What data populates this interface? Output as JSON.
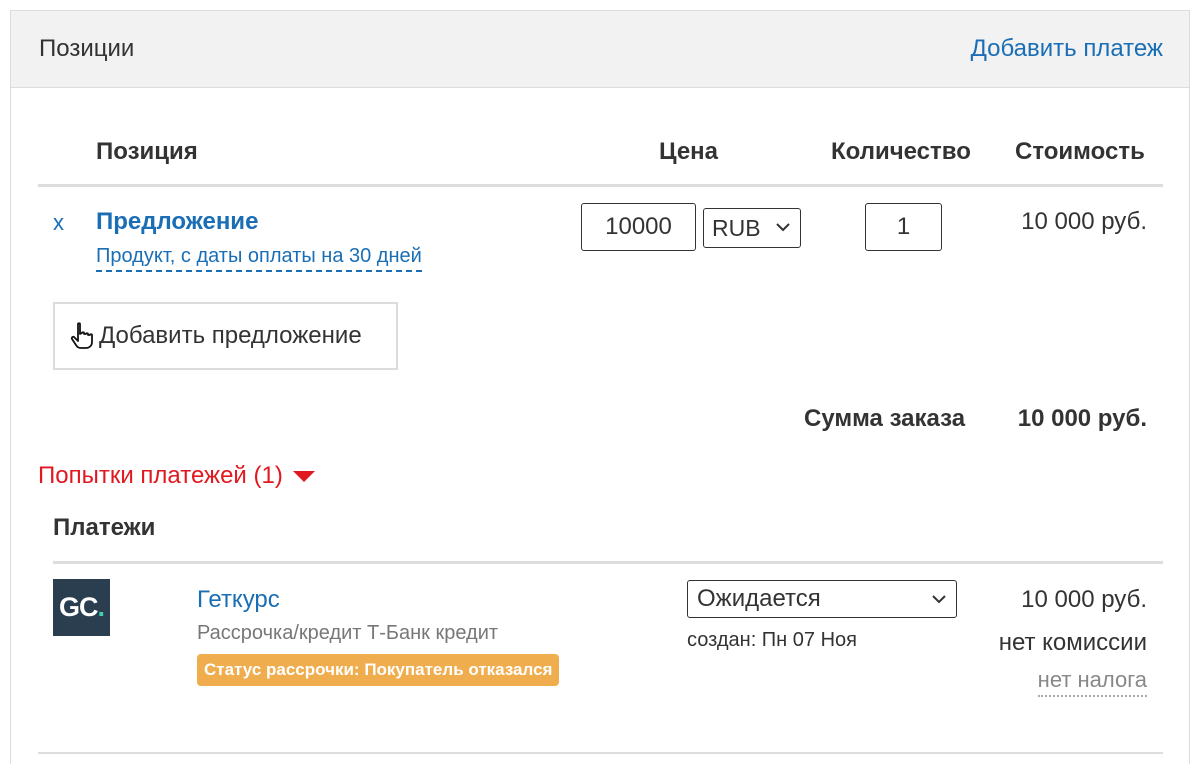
{
  "header": {
    "title": "Позиции",
    "add_payment_label": "Добавить платеж"
  },
  "table": {
    "columns": {
      "position": "Позиция",
      "price": "Цена",
      "quantity": "Количество",
      "cost": "Стоимость"
    },
    "rows": [
      {
        "remove_label": "x",
        "title": "Предложение",
        "subtitle": "Продукт, с даты оплаты на 30 дней",
        "price": "10000",
        "currency": "RUB",
        "quantity": "1",
        "cost": "10 000 руб."
      }
    ]
  },
  "add_offer_label": "Добавить предложение",
  "order_sum": {
    "label": "Сумма заказа",
    "value": "10 000 руб."
  },
  "attempts_label": "Попытки платежей (1)",
  "payments": {
    "title": "Платежи",
    "items": [
      {
        "logo_text": "GC",
        "logo_dot": ".",
        "provider": "Геткурс",
        "description": "Рассрочка/кредит Т-Банк кредит",
        "badge": "Статус рассрочки: Покупатель отказался",
        "status": "Ожидается",
        "created": "создан: Пн 07 Ноя",
        "amount": "10 000 руб.",
        "commission": "нет комиссии",
        "tax": "нет налога"
      }
    ]
  },
  "colors": {
    "link": "#1a6eb5",
    "attempts": "#e0181f",
    "badge": "#f0ad4e",
    "logo_bg": "#2b3e50",
    "logo_accent": "#3fcfb3"
  },
  "icons": {
    "add_offer": "pointing-hand-icon",
    "select": "chevron-down-icon",
    "attempts": "triangle-down-icon"
  }
}
